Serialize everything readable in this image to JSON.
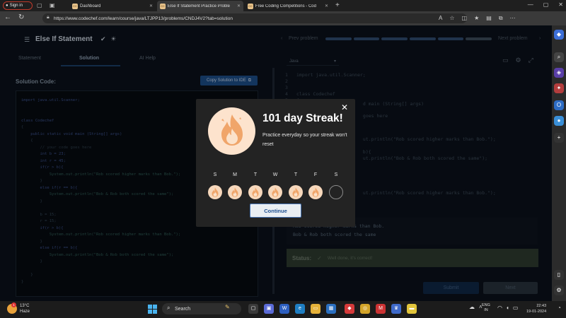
{
  "browser": {
    "signin_label": "Sign in",
    "tabs": [
      {
        "label": "Dashboard",
        "favicon": "CC"
      },
      {
        "label": "Else If Statement Practice Proble",
        "favicon": "CC"
      },
      {
        "label": "Free Coding Competitions - Cod",
        "favicon": "CC"
      }
    ],
    "new_tab": "+",
    "url": "https://www.codechef.com/learn/course/java/LTJPP13/problems/CNDJ4V2?tab=solution"
  },
  "page": {
    "problem_title": "Else If Statement",
    "prev_label": "Prev problem",
    "next_label": "Next problem",
    "tabs": [
      "Statement",
      "Solution",
      "AI Help"
    ],
    "solution_label": "Solution Code:",
    "copy_button": "Copy Solution to IDE",
    "language": "Java",
    "solution_code": [
      "import java.util.Scanner;",
      "",
      "",
      "class Codechef",
      "{",
      "    public static void main (String[] args)",
      "    {",
      "        // your code goes here",
      "        int b = 23;",
      "        int r = 45;",
      "        if(r > b){",
      "            System.out.println(\"Rob scored higher marks than Bob.\");",
      "        }",
      "        else if(r == b){",
      "            System.out.println(\"Bob & Rob both scored the same\");",
      "        }",
      "",
      "        b = 15;",
      "        r = 15;",
      "        if(r > b){",
      "            System.out.println(\"Rob scored higher marks than Bob.\");",
      "        }",
      "        else if(r == b){",
      "            System.out.println(\"Bob & Rob both scored the same\");",
      "        }",
      "",
      "    }",
      "}"
    ],
    "editor_lines": [
      {
        "n": "1",
        "text": "import java.util.Scanner;"
      },
      {
        "n": "2",
        "text": ""
      },
      {
        "n": "3",
        "text": ""
      },
      {
        "n": "4",
        "text": "class Codechef"
      },
      {
        "n": "5",
        "text": "{"
      },
      {
        "n": "",
        "text": "                        d main (String[] args)"
      },
      {
        "n": "",
        "text": "                        goes here"
      },
      {
        "n": "",
        "text": "                        ut.println(\"Rob scored higher marks than Bob.\");"
      },
      {
        "n": "",
        "text": "                        b){"
      },
      {
        "n": "",
        "text": "                        ut.println(\"Bob & Rob both scored the same\");"
      },
      {
        "n": "",
        "text": "                        ut.println(\"Rob scored higher marks than Bob.\");"
      }
    ],
    "output_lines": [
      "Rob scored higher marks than Bob.",
      "Bob & Rob both scored the same"
    ],
    "status_label": "Status:",
    "status_value": "Well done, it's correct!",
    "submit_button": "Submit",
    "next_button": "Next"
  },
  "modal": {
    "title": "101 day Streak!",
    "description": "Practice everyday so your streak won't reset",
    "days": [
      "S",
      "M",
      "T",
      "W",
      "T",
      "F",
      "S"
    ],
    "completed_days": 6,
    "continue_button": "Continue",
    "accent_color": "#f0a56a"
  },
  "taskbar": {
    "temperature": "13°C",
    "condition": "Haze",
    "weather_badge": "1",
    "search_label": "Search",
    "language_line1": "ENG",
    "language_line2": "IN",
    "time": "22:43",
    "date": "19-01-2024"
  }
}
